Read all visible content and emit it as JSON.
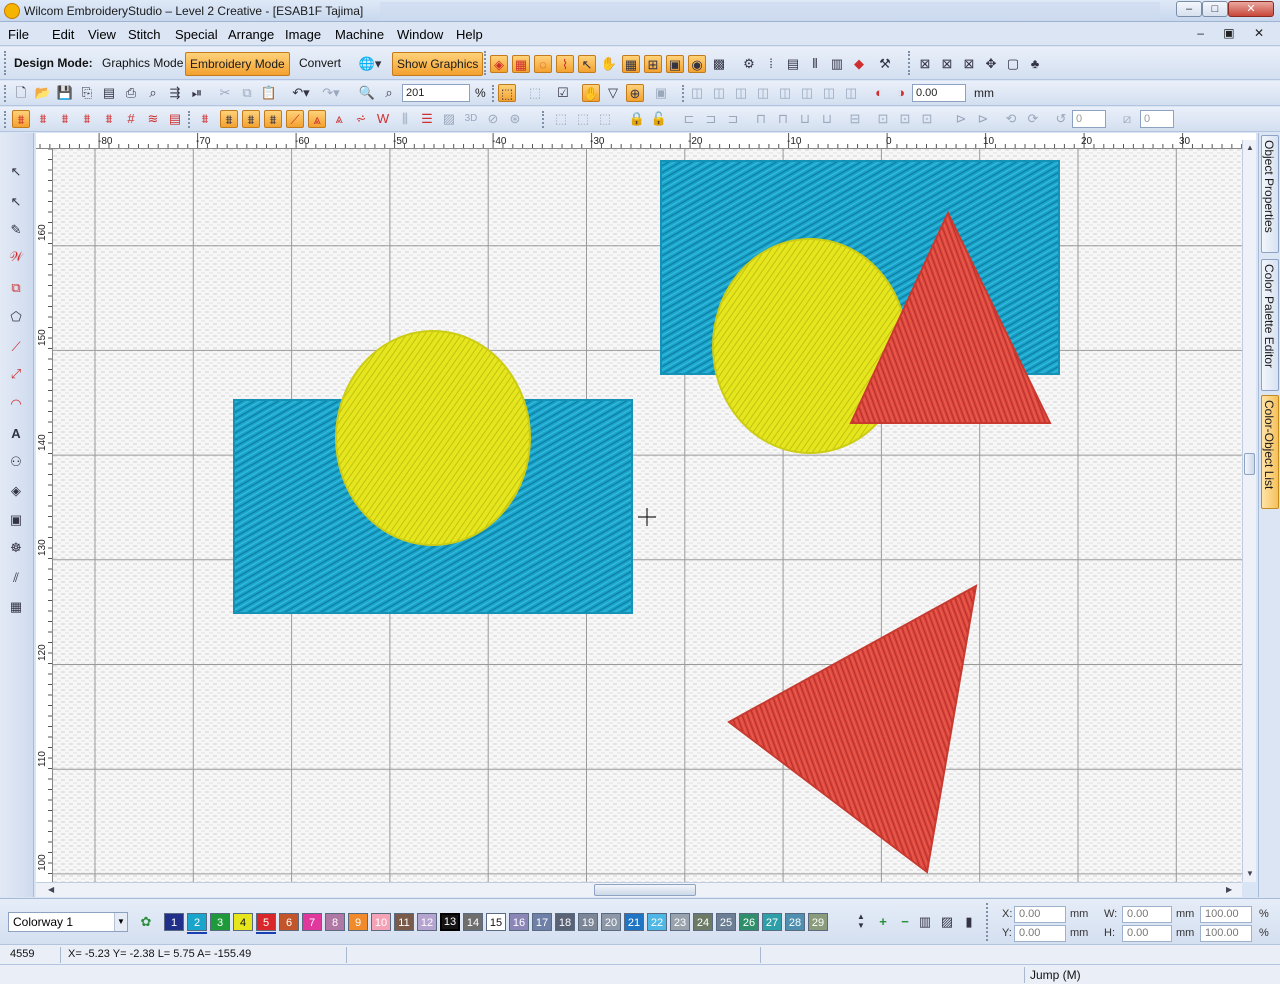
{
  "window": {
    "title": "Wilcom EmbroideryStudio – Level 2 Creative - [ESAB1F        Tajima]",
    "minimize": "–",
    "maximize": "□",
    "close": "✕"
  },
  "menu": {
    "items": [
      "File",
      "Edit",
      "View",
      "Stitch",
      "Special",
      "Arrange",
      "Image",
      "Machine",
      "Window",
      "Help"
    ],
    "mdi_controls": "– ▣ ✕"
  },
  "design_toolbar": {
    "label": "Design Mode:",
    "graphics_mode": "Graphics Mode",
    "embroidery_mode": "Embroidery Mode",
    "convert": "Convert",
    "show_graphics": "Show Graphics"
  },
  "standard_toolbar": {
    "zoom_value": "201",
    "zoom_unit": "%",
    "offset_value": "0.00",
    "offset_unit": "mm"
  },
  "stitch_toolbar": {
    "value_a": "0",
    "value_b": "0"
  },
  "rulers": {
    "horizontal": [
      "-80",
      "-70",
      "-60",
      "-50",
      "-40",
      "-30",
      "-20",
      "-10",
      "0",
      "10",
      "20",
      "30"
    ],
    "vertical": [
      "160",
      "150",
      "140",
      "130",
      "120",
      "110",
      "100"
    ]
  },
  "design": {
    "colors": {
      "blue": "#1aa6cc",
      "yellow": "#e6e61e",
      "red": "#e04a3f"
    },
    "objects": [
      "rectangle-left",
      "circle-left",
      "rectangle-right",
      "circle-right",
      "triangle-upper",
      "triangle-lower"
    ]
  },
  "dock_tabs": [
    "Object Properties",
    "Color Palette Editor",
    "Color-Object List"
  ],
  "colorbar": {
    "colorway": "Colorway 1",
    "swatches": [
      {
        "n": "1",
        "color": "#1f2f8a"
      },
      {
        "n": "2",
        "color": "#1aa6cc"
      },
      {
        "n": "3",
        "color": "#1f9a3b"
      },
      {
        "n": "4",
        "color": "#e6e61e"
      },
      {
        "n": "5",
        "color": "#d9262b"
      },
      {
        "n": "6",
        "color": "#c2552a"
      },
      {
        "n": "7",
        "color": "#e0389c"
      },
      {
        "n": "8",
        "color": "#b078a4"
      },
      {
        "n": "9",
        "color": "#f08a2a"
      },
      {
        "n": "10",
        "color": "#f4a3b7"
      },
      {
        "n": "11",
        "color": "#7a5a4a"
      },
      {
        "n": "12",
        "color": "#b5a4cf"
      },
      {
        "n": "13",
        "color": "#141414"
      },
      {
        "n": "14",
        "color": "#6e6e6e"
      },
      {
        "n": "15",
        "color": "#ffffff"
      },
      {
        "n": "16",
        "color": "#8a86b8"
      },
      {
        "n": "17",
        "color": "#6e7fa8"
      },
      {
        "n": "18",
        "color": "#5a6275"
      },
      {
        "n": "19",
        "color": "#7c8696"
      },
      {
        "n": "20",
        "color": "#8c97a8"
      },
      {
        "n": "21",
        "color": "#1f74c4"
      },
      {
        "n": "22",
        "color": "#4fb7e6"
      },
      {
        "n": "23",
        "color": "#9aa3ad"
      },
      {
        "n": "24",
        "color": "#6d7a66"
      },
      {
        "n": "25",
        "color": "#6c7f95"
      },
      {
        "n": "26",
        "color": "#2f8f6a"
      },
      {
        "n": "27",
        "color": "#2c9fa8"
      },
      {
        "n": "28",
        "color": "#4f8fb0"
      },
      {
        "n": "29",
        "color": "#8a9c7c"
      }
    ],
    "x_label": "X:",
    "x_value": "0.00",
    "x_unit": "mm",
    "y_label": "Y:",
    "y_value": "0.00",
    "y_unit": "mm",
    "w_label": "W:",
    "w_value": "0.00",
    "w_unit": "mm",
    "w_pct": "100.00",
    "w_pct_unit": "%",
    "h_label": "H:",
    "h_value": "0.00",
    "h_unit": "mm",
    "h_pct": "100.00",
    "h_pct_unit": "%"
  },
  "status": {
    "stitch_count": "4559",
    "coords": "X=  -5.23 Y=  -2.38 L=   5.75 A= -155.49",
    "mode": "Jump (M)"
  }
}
